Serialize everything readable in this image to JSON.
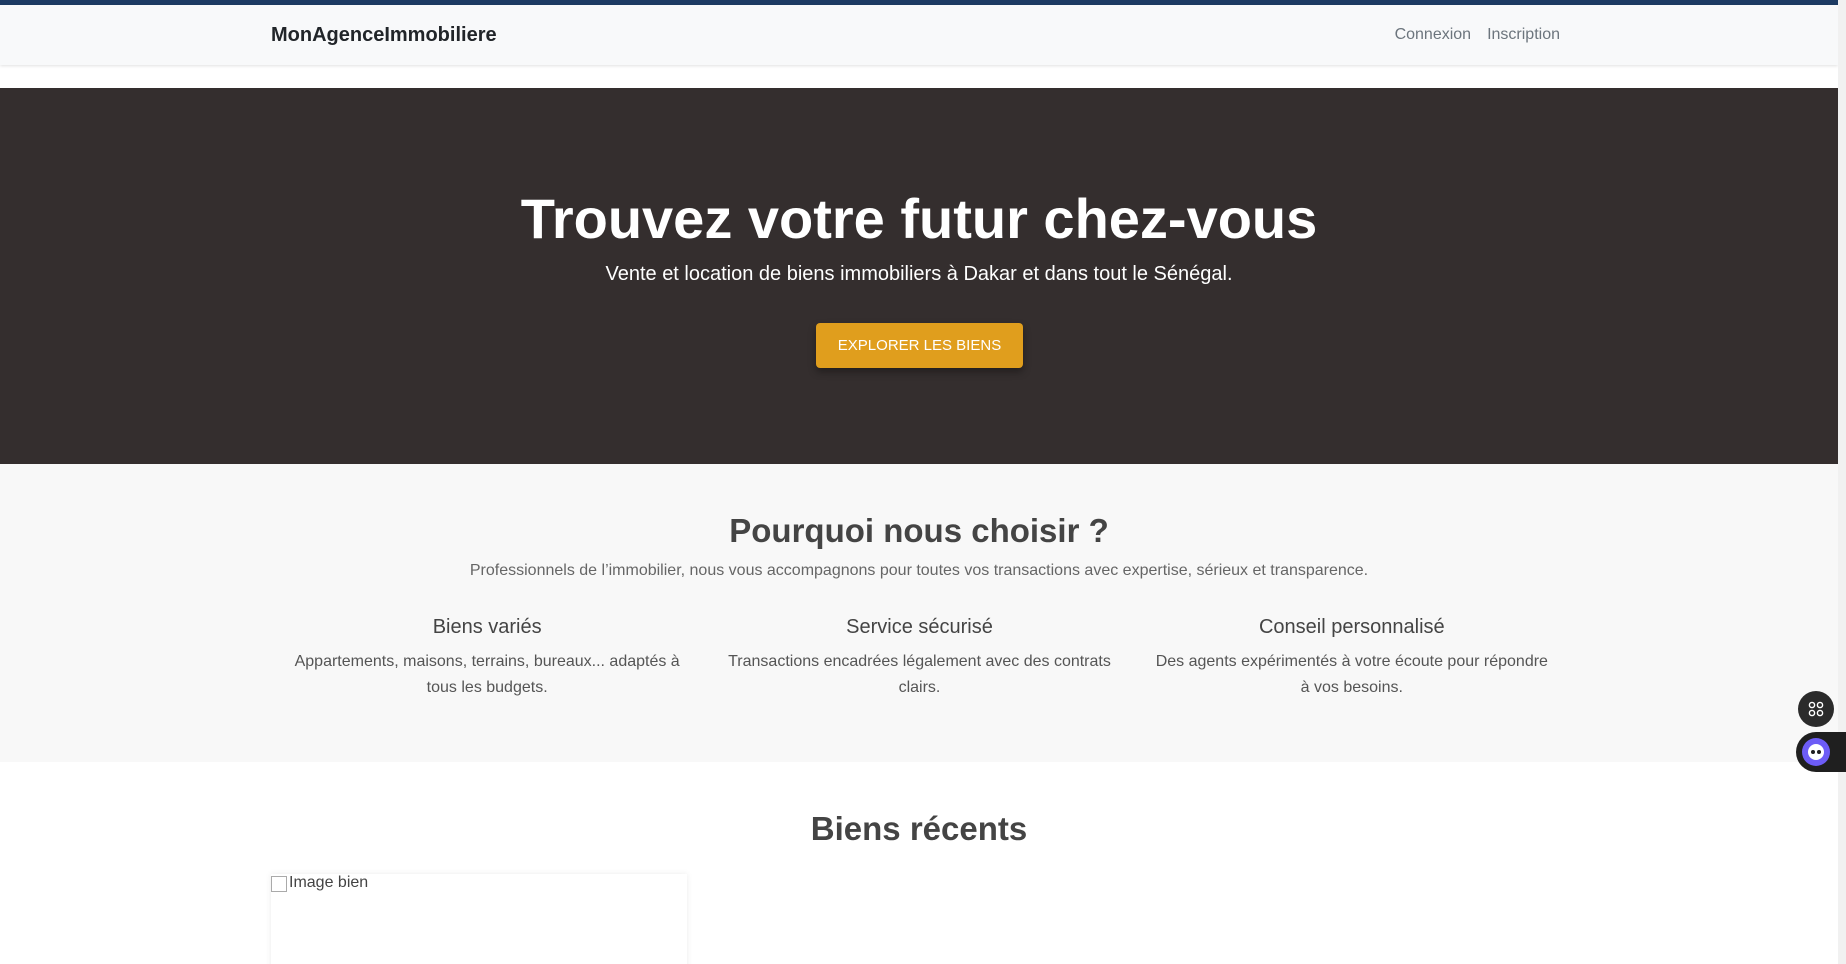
{
  "navbar": {
    "brand": "MonAgenceImmobiliere",
    "links": [
      {
        "label": "Connexion"
      },
      {
        "label": "Inscription"
      }
    ]
  },
  "hero": {
    "title": "Trouvez votre futur chez-vous",
    "subtitle": "Vente et location de biens immobiliers à Dakar et dans tout le Sénégal.",
    "cta_label": "EXPLORER LES BIENS"
  },
  "why": {
    "title": "Pourquoi nous choisir ?",
    "lead": "Professionnels de l’immobilier, nous vous accompagnons pour toutes vos transactions avec expertise, sérieux et transparence.",
    "features": [
      {
        "title": "Biens variés",
        "text": "Appartements, maisons, terrains, bureaux... adaptés à tous les budgets."
      },
      {
        "title": "Service sécurisé",
        "text": "Transactions encadrées légalement avec des contrats clairs."
      },
      {
        "title": "Conseil personnalisé",
        "text": "Des agents expérimentés à votre écoute pour répondre à vos besoins."
      }
    ]
  },
  "recent": {
    "title": "Biens récents",
    "cards": [
      {
        "image_alt": "Image bien"
      }
    ]
  },
  "colors": {
    "accent_bar": "#1d3b63",
    "hero_bg": "#342e2e",
    "cta_bg": "#e09e1d",
    "section_bg": "#f8f8f8"
  },
  "icons": {
    "float_button": "grid-icon",
    "assistant": "assistant-icon"
  }
}
